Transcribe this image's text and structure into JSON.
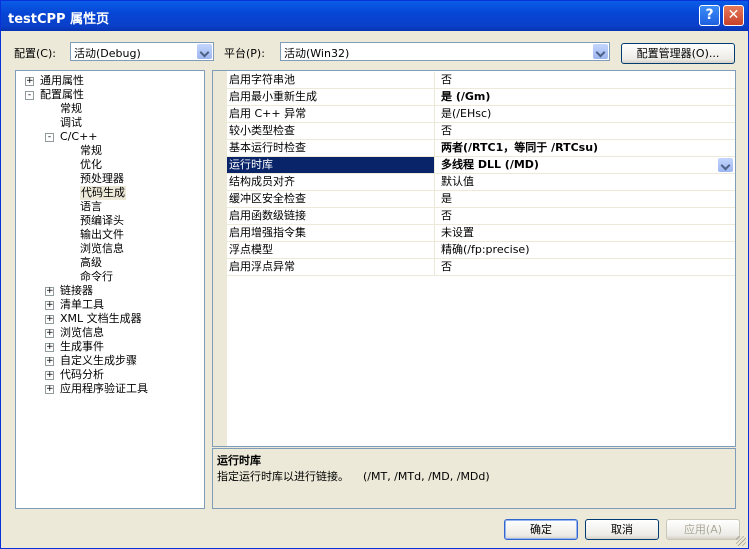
{
  "window": {
    "title": "testCPP 属性页",
    "help_symbol": "?",
    "close_symbol": "✕"
  },
  "config": {
    "label": "配置(C):",
    "value": "活动(Debug)"
  },
  "platform": {
    "label": "平台(P):",
    "value": "活动(Win32)"
  },
  "config_manager_label": "配置管理器(O)...",
  "tree": [
    {
      "label": "通用属性",
      "level": 0,
      "expander": "+"
    },
    {
      "label": "配置属性",
      "level": 0,
      "expander": "-"
    },
    {
      "label": "常规",
      "level": 1,
      "expander": ""
    },
    {
      "label": "调试",
      "level": 1,
      "expander": ""
    },
    {
      "label": "C/C++",
      "level": 1,
      "expander": "-"
    },
    {
      "label": "常规",
      "level": 2,
      "expander": ""
    },
    {
      "label": "优化",
      "level": 2,
      "expander": ""
    },
    {
      "label": "预处理器",
      "level": 2,
      "expander": ""
    },
    {
      "label": "代码生成",
      "level": 2,
      "expander": "",
      "selected": true
    },
    {
      "label": "语言",
      "level": 2,
      "expander": ""
    },
    {
      "label": "预编译头",
      "level": 2,
      "expander": ""
    },
    {
      "label": "输出文件",
      "level": 2,
      "expander": ""
    },
    {
      "label": "浏览信息",
      "level": 2,
      "expander": ""
    },
    {
      "label": "高级",
      "level": 2,
      "expander": ""
    },
    {
      "label": "命令行",
      "level": 2,
      "expander": ""
    },
    {
      "label": "链接器",
      "level": 1,
      "expander": "+"
    },
    {
      "label": "清单工具",
      "level": 1,
      "expander": "+"
    },
    {
      "label": "XML 文档生成器",
      "level": 1,
      "expander": "+"
    },
    {
      "label": "浏览信息",
      "level": 1,
      "expander": "+"
    },
    {
      "label": "生成事件",
      "level": 1,
      "expander": "+"
    },
    {
      "label": "自定义生成步骤",
      "level": 1,
      "expander": "+"
    },
    {
      "label": "代码分析",
      "level": 1,
      "expander": "+"
    },
    {
      "label": "应用程序验证工具",
      "level": 1,
      "expander": "+"
    }
  ],
  "properties": [
    {
      "name": "启用字符串池",
      "value": "否",
      "bold": false
    },
    {
      "name": "启用最小重新生成",
      "value": "是 (/Gm)",
      "bold": true
    },
    {
      "name": "启用 C++ 异常",
      "value": "是(/EHsc)",
      "bold": false
    },
    {
      "name": "较小类型检查",
      "value": "否",
      "bold": false
    },
    {
      "name": "基本运行时检查",
      "value": "两者(/RTC1，等同于 /RTCsu)",
      "bold": true
    },
    {
      "name": "运行时库",
      "value": "多线程 DLL (/MD)",
      "bold": true,
      "selected": true
    },
    {
      "name": "结构成员对齐",
      "value": "默认值",
      "bold": false
    },
    {
      "name": "缓冲区安全检查",
      "value": "是",
      "bold": false
    },
    {
      "name": "启用函数级链接",
      "value": "否",
      "bold": false
    },
    {
      "name": "启用增强指令集",
      "value": "未设置",
      "bold": false
    },
    {
      "name": "浮点模型",
      "value": "精确(/fp:precise)",
      "bold": false
    },
    {
      "name": "启用浮点异常",
      "value": "否",
      "bold": false
    }
  ],
  "description": {
    "title": "运行时库",
    "text": "指定运行时库以进行链接。    (/MT, /MTd, /MD, /MDd)"
  },
  "buttons": {
    "ok": "确定",
    "cancel": "取消",
    "apply": "应用(A)"
  },
  "colors": {
    "title_bar": "#0a5de8",
    "selection": "#0a246a",
    "window_bg": "#ece9d8"
  }
}
